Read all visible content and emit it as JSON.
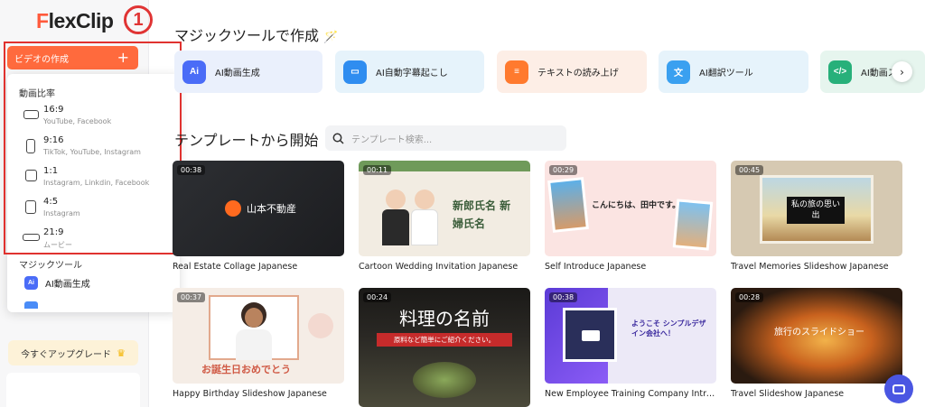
{
  "brand": {
    "logo": "FlexClip",
    "annotation_number": "1"
  },
  "sidebar": {
    "create_button": "ビデオの作成",
    "aspect_header": "動画比率",
    "aspect_ratios": [
      {
        "ratio": "16:9",
        "platforms": "YouTube, Facebook"
      },
      {
        "ratio": "9:16",
        "platforms": "TikTok, YouTube, Instagram"
      },
      {
        "ratio": "1:1",
        "platforms": "Instagram, Linkdin, Facebook"
      },
      {
        "ratio": "4:5",
        "platforms": "Instagram"
      },
      {
        "ratio": "21:9",
        "platforms": "ムービー"
      }
    ],
    "magic_header": "マジックツール",
    "magic_items": [
      {
        "label": "AI動画生成",
        "icon": "ai-video-icon"
      }
    ],
    "upgrade_button": "今すぐアップグレード"
  },
  "magic_section": {
    "title": "マジックツールで作成",
    "tools": [
      {
        "label": "AI動画生成",
        "icon": "ai-video-icon",
        "bg": "#eaf0fc",
        "icon_bg": "#4a6cf7"
      },
      {
        "label": "AI自動字幕起こし",
        "icon": "subtitle-icon",
        "bg": "#e6f3fb",
        "icon_bg": "#2f8df0"
      },
      {
        "label": "テキストの読み上げ",
        "icon": "speech-icon",
        "bg": "#fdeee6",
        "icon_bg": "#ff7a2e"
      },
      {
        "label": "AI翻訳ツール",
        "icon": "translate-icon",
        "bg": "#e6f3fb",
        "icon_bg": "#3aa0f0"
      },
      {
        "label": "AI動画ス",
        "icon": "ai-script-icon",
        "bg": "#e6f5ee",
        "icon_bg": "#27b07a"
      }
    ]
  },
  "templates_section": {
    "title": "テンプレートから開始",
    "search_placeholder": "テンプレート検索...",
    "templates": [
      {
        "title": "Real Estate Collage Japanese",
        "duration": "00:38",
        "thumb_text": "山本不動産"
      },
      {
        "title": "Cartoon Wedding Invitation Japanese",
        "duration": "00:11",
        "thumb_text": "新郎氏名 新婦氏名"
      },
      {
        "title": "Self Introduce Japanese",
        "duration": "00:29",
        "thumb_text": "こんにちは、田中です。"
      },
      {
        "title": "Travel Memories Slideshow Japanese",
        "duration": "00:45",
        "thumb_text": "私の旅の思い出"
      },
      {
        "title": "Happy Birthday Slideshow Japanese",
        "duration": "00:37",
        "thumb_text": "お誕生日おめでとう"
      },
      {
        "title": "",
        "duration": "00:24",
        "thumb_text": "料理の名前",
        "thumb_sub": "原料など簡単にご紹介ください。"
      },
      {
        "title": "New Employee Training Company Introducti…",
        "duration": "00:38",
        "thumb_text": "ようこそ シンプルデザイン会社へ！"
      },
      {
        "title": "Travel Slideshow Japanese",
        "duration": "00:28",
        "thumb_text": "旅行のスライドショー"
      }
    ]
  },
  "colors": {
    "accent": "#ff6a3d",
    "highlight_frame": "#e0322f"
  }
}
